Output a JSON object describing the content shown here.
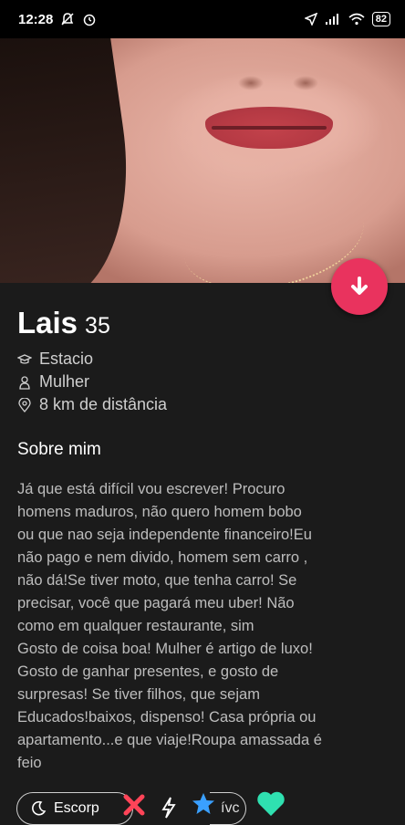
{
  "status_bar": {
    "time": "12:28",
    "battery": "82"
  },
  "profile": {
    "name": "Lais",
    "age": "35",
    "school": "Estacio",
    "gender": "Mulher",
    "distance": "8 km de distância"
  },
  "about": {
    "title": "Sobre mim",
    "bio": "Já que está difícil vou escrever! Procuro\nhomens maduros, não quero homem bobo\nou que nao seja independente financeiro!Eu\nnão pago e nem divido, homem sem carro ,\nnão dá!Se tiver moto, que tenha carro! Se\nprecisar, você que pagará meu uber! Não\ncomo em qualquer restaurante, sim\nGosto de coisa boa! Mulher é artigo de luxo!\nGosto de ganhar presentes, e gosto de\nsurpresas! Se tiver filhos, que sejam\nEducados!baixos, dispenso! Casa própria ou\napartamento...e que viaje!Roupa amassada é\nfeio"
  },
  "actions": {
    "pill_left_label": "Escorp",
    "pill_right_label": "ívc"
  },
  "colors": {
    "accent": "#e9335e",
    "heart": "#2fe0b0",
    "star": "#3aa0ff",
    "x": "#ff4458"
  }
}
